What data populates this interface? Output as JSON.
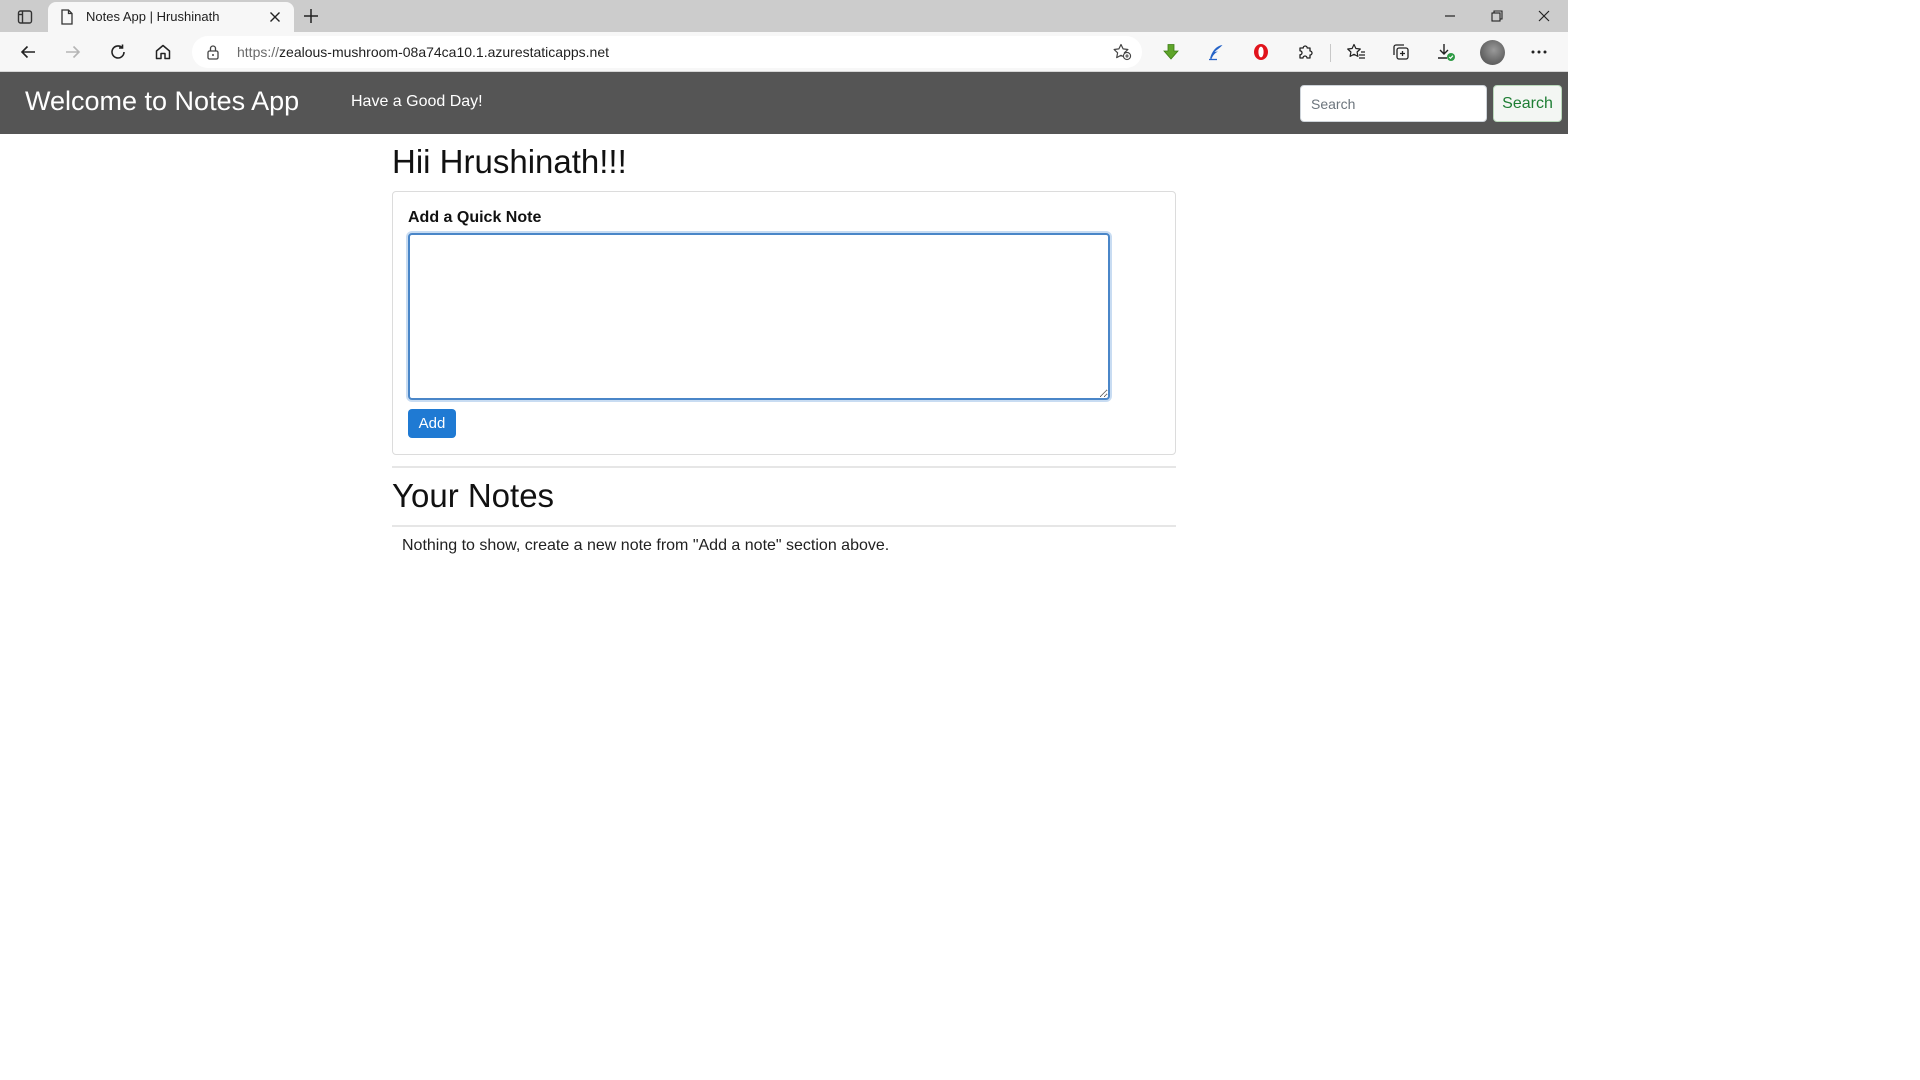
{
  "browser": {
    "tab_title": "Notes App | Hrushinath",
    "url_scheme": "https://",
    "url_host": "zealous-mushroom-08a74ca10.1.azurestaticapps.net",
    "icons": {
      "tab_actions": "tab-actions-icon",
      "page": "page-icon",
      "tab_close": "close-icon",
      "new_tab": "plus-icon",
      "back": "back-arrow-icon",
      "forward": "forward-arrow-icon",
      "refresh": "refresh-icon",
      "home": "home-icon",
      "lock": "lock-icon",
      "add_favorite": "add-favorite-icon",
      "extension_download": "green-download-arrow-icon",
      "extension_pen": "blue-feather-pen-icon",
      "extension_opera": "red-o-icon",
      "extensions": "puzzle-piece-icon",
      "favorites": "favorites-star-icon",
      "collections": "collections-icon",
      "downloads": "download-icon",
      "profile": "avatar",
      "more": "more-dots-icon"
    }
  },
  "navbar": {
    "brand": "Welcome to Notes App",
    "link": "Have a Good Day!",
    "search_placeholder": "Search",
    "search_button": "Search"
  },
  "main": {
    "greeting": "Hii Hrushinath!!!",
    "add_note_label": "Add a Quick Note",
    "note_value": "",
    "add_button": "Add",
    "notes_heading": "Your Notes",
    "empty_message": "Nothing to show, create a new note from \"Add a note\" section above."
  },
  "colors": {
    "navbar_bg": "#555555",
    "primary_button": "#1f7ad3",
    "search_button_text": "#1e7e34",
    "textarea_border": "#4a86c8"
  }
}
